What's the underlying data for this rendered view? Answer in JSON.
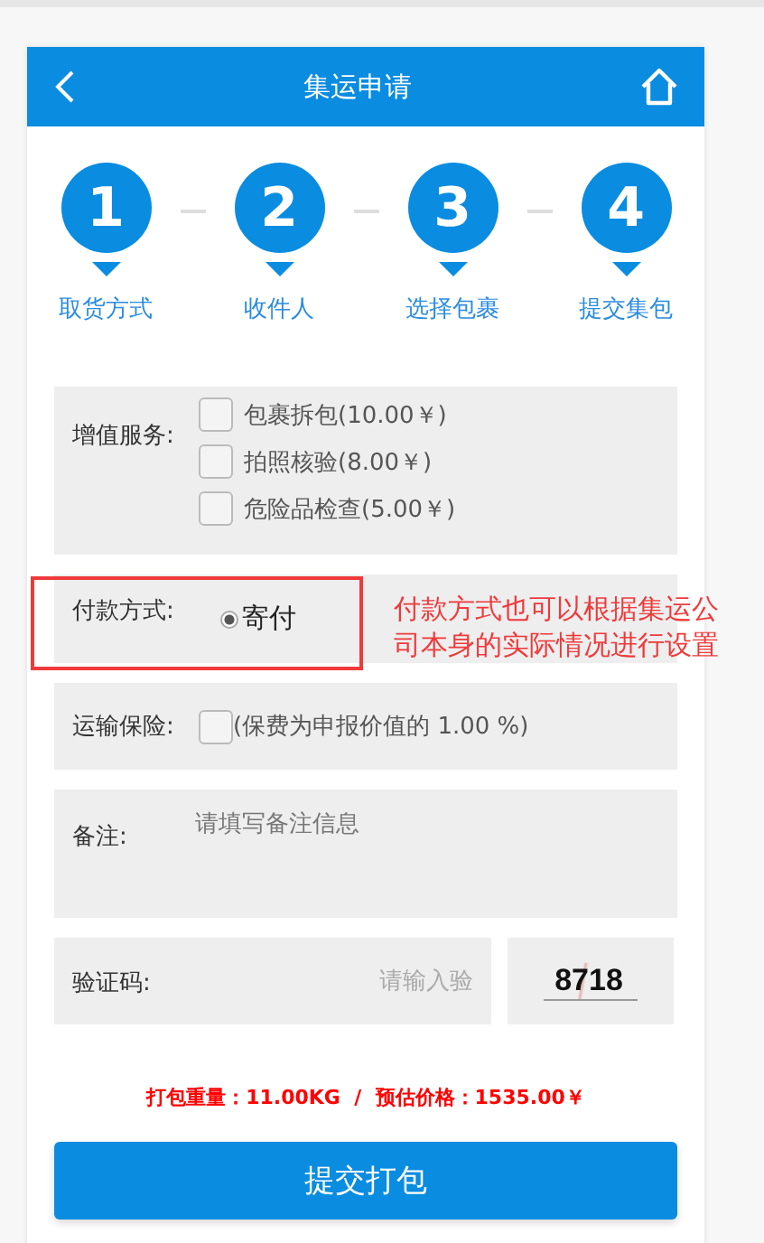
{
  "header": {
    "title": "集运申请"
  },
  "steps": [
    {
      "number": "1",
      "label": "取货方式"
    },
    {
      "number": "2",
      "label": "收件人"
    },
    {
      "number": "3",
      "label": "选择包裹"
    },
    {
      "number": "4",
      "label": "提交集包"
    }
  ],
  "services": {
    "label": "增值服务:",
    "options": [
      {
        "label": "包裹拆包(10.00￥)",
        "checked": false
      },
      {
        "label": "拍照核验(8.00￥)",
        "checked": false
      },
      {
        "label": "危险品检查(5.00￥)",
        "checked": false
      }
    ]
  },
  "payment": {
    "label": "付款方式:",
    "options": [
      {
        "label": "寄付",
        "selected": true
      }
    ]
  },
  "annotation": "付款方式也可以根据集运公司本身的实际情况进行设置",
  "insurance": {
    "label": "运输保险:",
    "checked": false,
    "note": "(保费为申报价值的 1.00 %)"
  },
  "remark": {
    "label": "备注:",
    "placeholder": "请填写备注信息"
  },
  "captcha": {
    "label": "验证码:",
    "placeholder": "请输入验",
    "code": "8718"
  },
  "summary": "打包重量：11.00KG  /  预估价格：1535.00￥",
  "submit": "提交打包"
}
